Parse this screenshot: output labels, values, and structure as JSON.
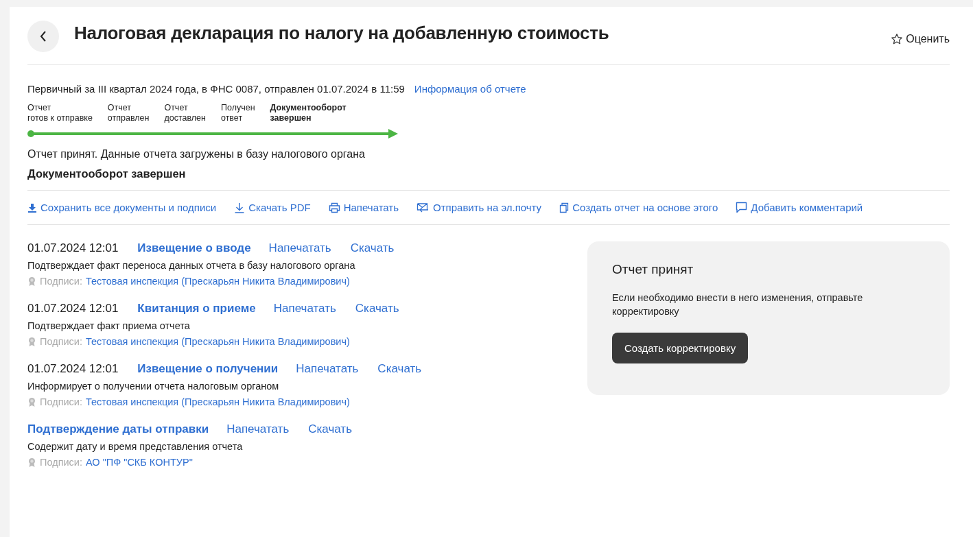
{
  "header": {
    "title": "Налоговая декларация по налогу на добавленную стоимость",
    "rate": "Оценить"
  },
  "summary": {
    "text": "Первичный за III квартал 2024 года, в ФНС 0087, отправлен 01.07.2024 в 11:59",
    "link": "Информация об отчете"
  },
  "progress": {
    "steps": [
      {
        "label": "Отчет\nготов к отправке",
        "selected": false
      },
      {
        "label": "Отчет\nотправлен",
        "selected": false
      },
      {
        "label": "Отчет\nдоставлен",
        "selected": false
      },
      {
        "label": "Получен\nответ",
        "selected": false
      },
      {
        "label": "Документооборот\nзавершен",
        "selected": true
      }
    ]
  },
  "status": {
    "message": "Отчет принят. Данные отчета загружены в базу налогового органа",
    "title": "Документооборот завершен"
  },
  "actions": [
    {
      "kind": "save",
      "label": "Сохранить все документы и подписи"
    },
    {
      "kind": "download",
      "label": "Скачать PDF"
    },
    {
      "kind": "print",
      "label": "Напечатать"
    },
    {
      "kind": "mail",
      "label": "Отправить на эл.почту"
    },
    {
      "kind": "copy",
      "label": "Создать отчет на основе этого"
    },
    {
      "kind": "comment",
      "label": "Добавить комментарий"
    }
  ],
  "documents": [
    {
      "date": "01.07.2024 12:01",
      "title": "Извещение о вводе",
      "print": "Напечатать",
      "download": "Скачать",
      "description": "Подтверждает факт переноса данных отчета в базу налогового органа",
      "signatures_label": "Подписи:",
      "signer": "Тестовая инспекция (Прескарьян Никита Владимирович)"
    },
    {
      "date": "01.07.2024 12:01",
      "title": "Квитанция о приеме",
      "print": "Напечатать",
      "download": "Скачать",
      "description": "Подтверждает факт приема отчета",
      "signatures_label": "Подписи:",
      "signer": "Тестовая инспекция (Прескарьян Никита Владимирович)"
    },
    {
      "date": "01.07.2024 12:01",
      "title": "Извещение о получении",
      "print": "Напечатать",
      "download": "Скачать",
      "description": "Информирует о получении отчета налоговым органом",
      "signatures_label": "Подписи:",
      "signer": "Тестовая инспекция (Прескарьян Никита Владимирович)"
    },
    {
      "title": "Подтверждение даты отправки",
      "print": "Напечатать",
      "download": "Скачать",
      "description": "Содержит дату и время представления отчета",
      "signatures_label": "Подписи:",
      "signer": "АО \"ПФ \"СКБ КОНТУР\""
    }
  ],
  "side_card": {
    "title": "Отчет принят",
    "text": "Если необходимо внести в него изменения, отправьте корректировку",
    "button": "Создать корректировку"
  }
}
